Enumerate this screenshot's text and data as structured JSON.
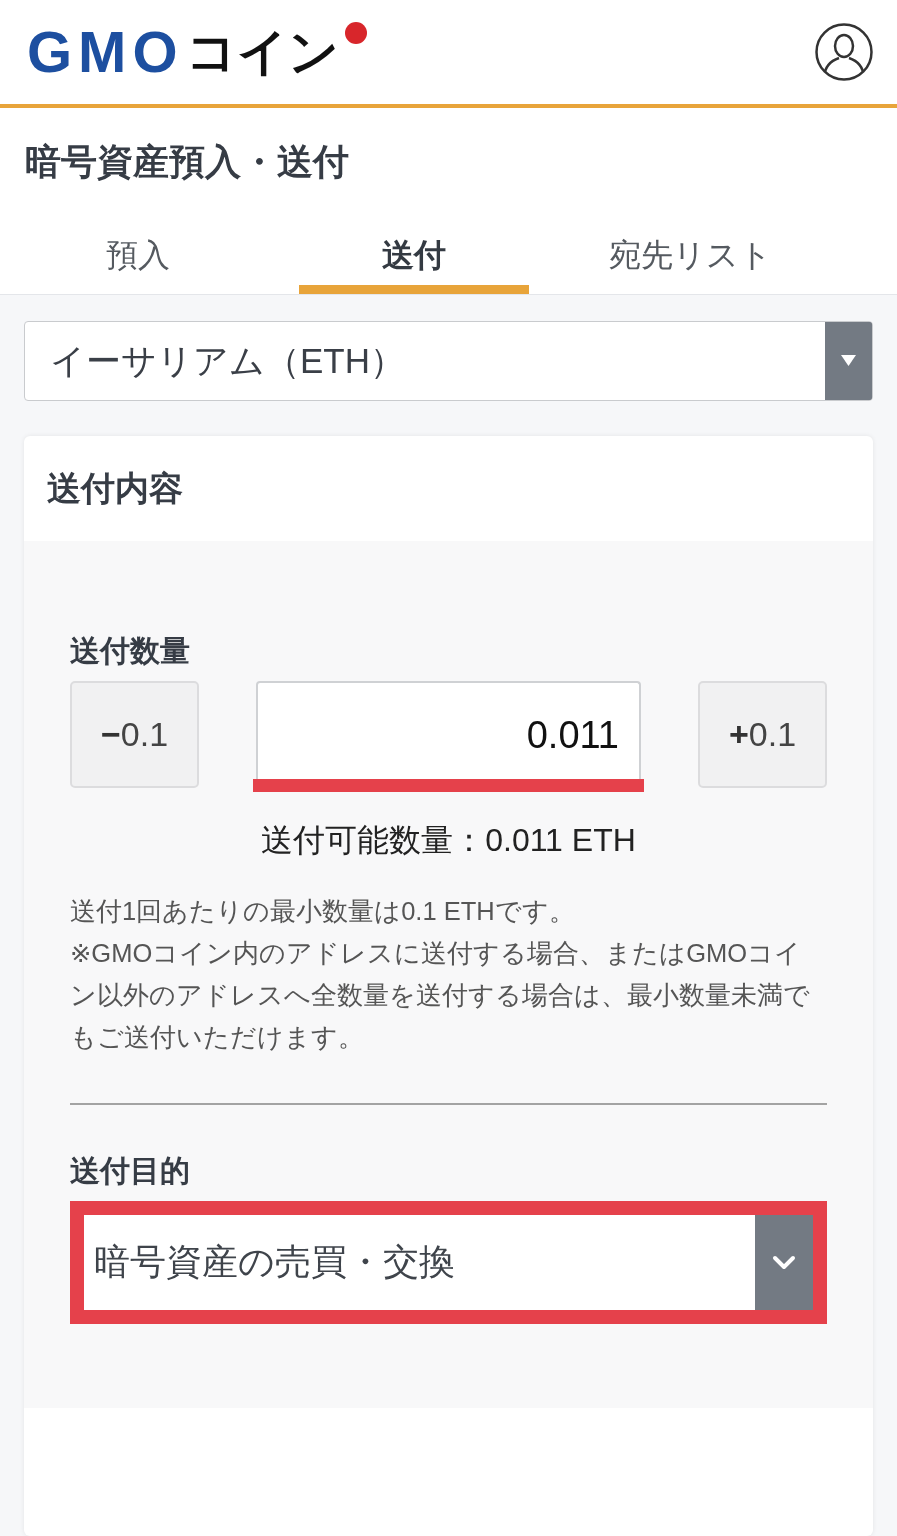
{
  "header": {
    "logo": {
      "latin": "GMO",
      "kana": "コイン"
    }
  },
  "page_title": "暗号資産預入・送付",
  "tabs": [
    {
      "label": "預入",
      "selected": false
    },
    {
      "label": "送付",
      "selected": true
    },
    {
      "label": "宛先リスト",
      "selected": false
    }
  ],
  "currency_select": {
    "value": "イーサリアム（ETH）"
  },
  "send_card": {
    "title": "送付内容",
    "amount": {
      "label": "送付数量",
      "decrement_button": "**−**0.1",
      "field": {
        "value": "0.011",
        "highlighted": true
      },
      "increment_button": "**+**0.1",
      "available": "送付可能数量：0.011 ETH"
    },
    "notes": [
      "送付1回あたりの最小数量は0.1 ETHです。",
      "※GMOコイン内のアドレスに送付する場合、またはGMOコイン以外のアドレスへ全数量を送付する場合は、最小数量未満でもご送付いただけます。"
    ],
    "purpose": {
      "label": "送付目的",
      "select": {
        "value": "暗号資産の売買・交換",
        "highlighted": true
      }
    }
  }
}
